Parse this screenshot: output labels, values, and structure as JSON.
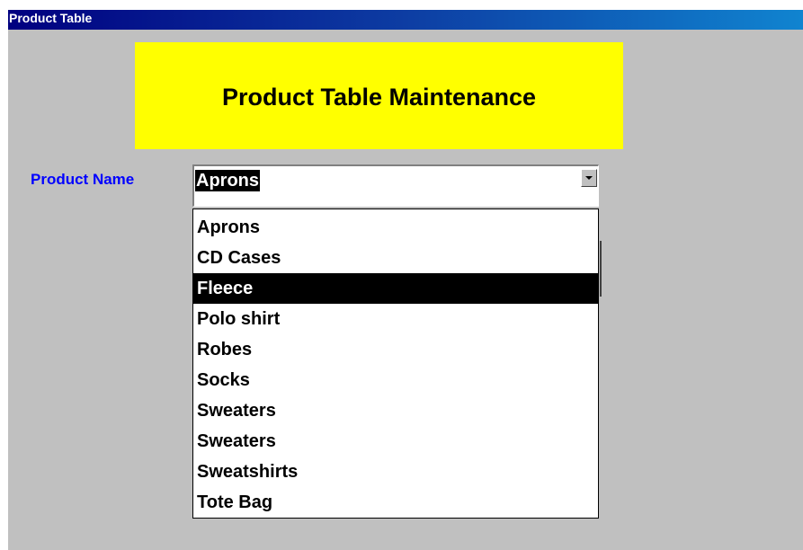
{
  "window": {
    "title": "Product Table"
  },
  "banner": {
    "heading": "Product Table Maintenance"
  },
  "form": {
    "product_name_label": "Product Name",
    "product_name_value": "Aprons"
  },
  "dropdown": {
    "selected_index": 2,
    "items": [
      {
        "label": "Aprons"
      },
      {
        "label": "CD Cases"
      },
      {
        "label": "Fleece"
      },
      {
        "label": "Polo shirt"
      },
      {
        "label": "Robes"
      },
      {
        "label": "Socks"
      },
      {
        "label": "Sweaters"
      },
      {
        "label": "Sweaters"
      },
      {
        "label": "Sweatshirts"
      },
      {
        "label": "Tote Bag"
      }
    ]
  },
  "colors": {
    "title_bar_start": "#000080",
    "title_bar_end": "#1084d0",
    "window_background": "#c0c0c0",
    "banner_background": "#ffff00",
    "label_color": "#0000ff",
    "highlight_background": "#000000",
    "highlight_text": "#ffffff"
  },
  "icons": {
    "combo_button": "chevron-down-icon"
  }
}
